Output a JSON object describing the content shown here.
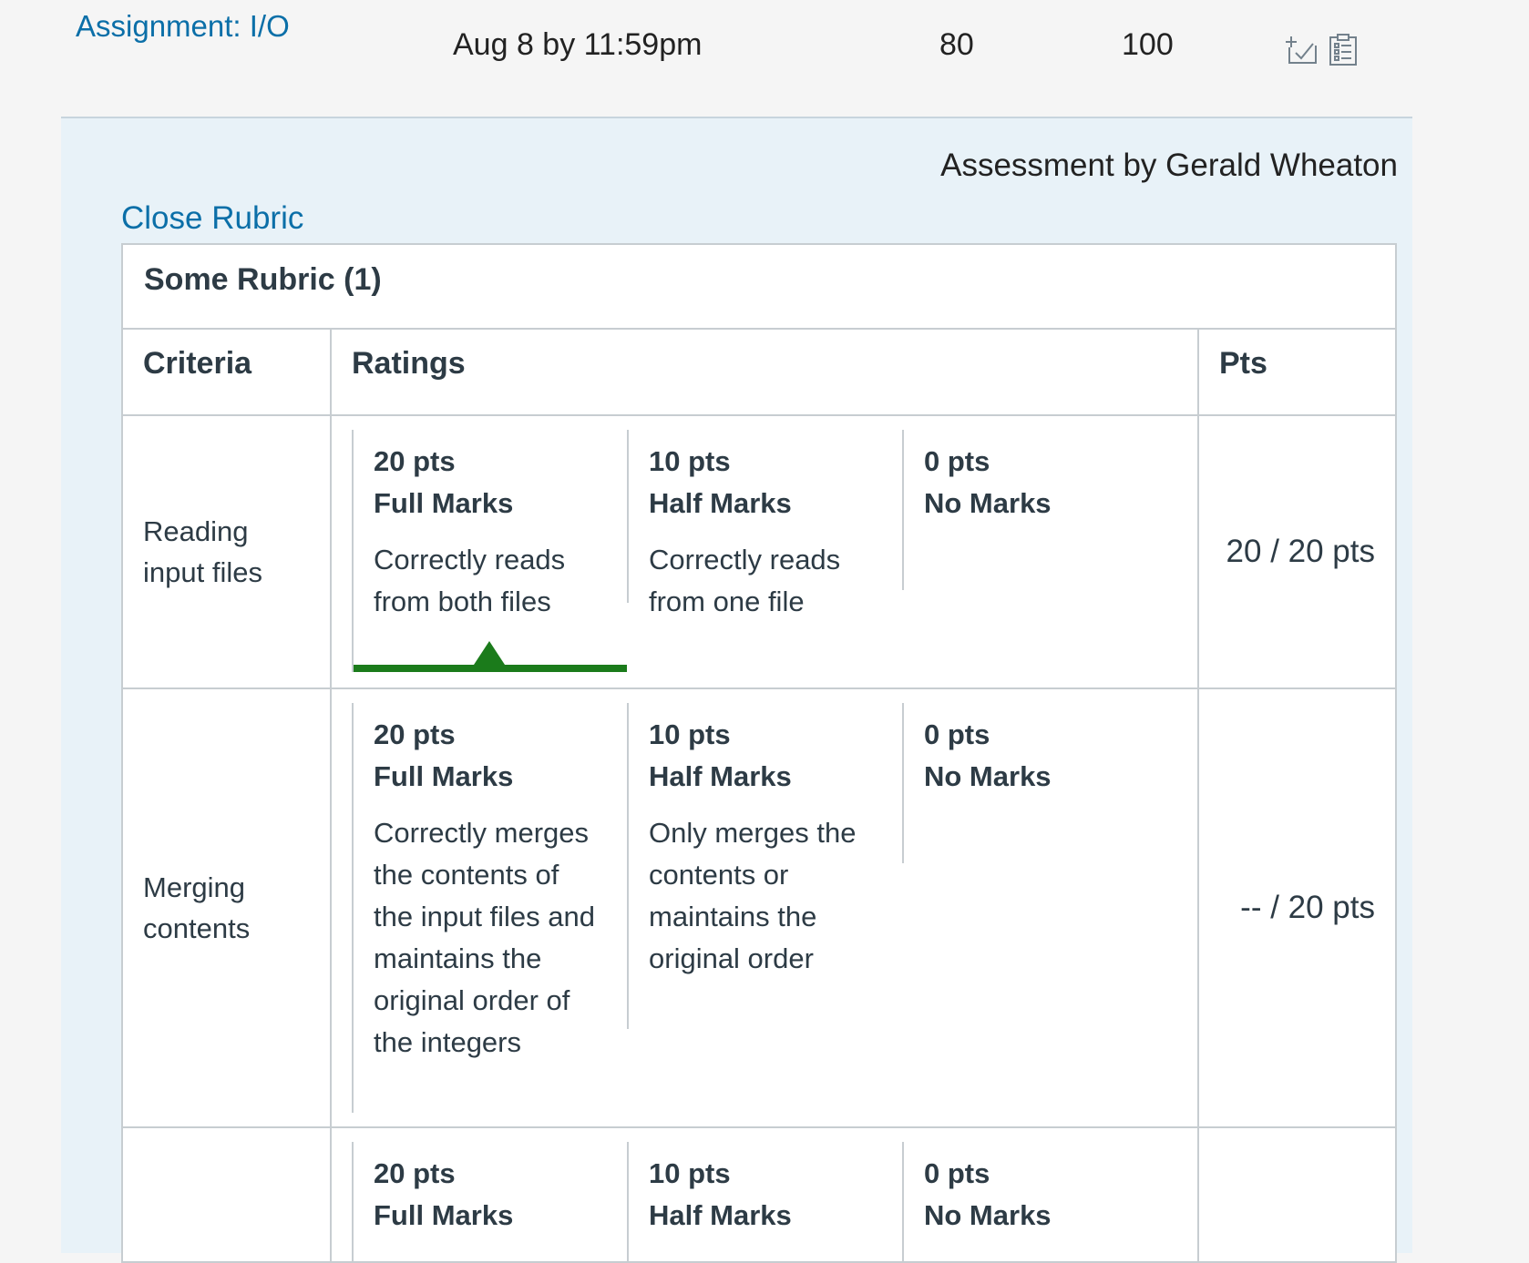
{
  "assignment": {
    "title": "Assignment: I/O",
    "due": "Aug 8 by 11:59pm",
    "score": "80",
    "out_of": "100",
    "icons": [
      "muted-checklist-icon",
      "rubric-clipboard-icon"
    ]
  },
  "rubric": {
    "assessed_by": "Assessment by Gerald Wheaton",
    "close_label": "Close Rubric",
    "title": "Some Rubric (1)",
    "headers": {
      "criteria": "Criteria",
      "ratings": "Ratings",
      "pts": "Pts"
    },
    "criteria": [
      {
        "name": "Reading input files",
        "score": "20 / 20 pts",
        "ratings": [
          {
            "pts": "20 pts",
            "name": "Full Marks",
            "desc": "Correctly reads from both files",
            "selected": true
          },
          {
            "pts": "10 pts",
            "name": "Half Marks",
            "desc": "Correctly reads from one file",
            "selected": false
          },
          {
            "pts": "0 pts",
            "name": "No Marks",
            "desc": "",
            "selected": false
          }
        ]
      },
      {
        "name": "Merging contents",
        "score": "-- / 20 pts",
        "ratings": [
          {
            "pts": "20 pts",
            "name": "Full Marks",
            "desc": "Correctly merges the contents of the input files and maintains the original order of the integers",
            "selected": false
          },
          {
            "pts": "10 pts",
            "name": "Half Marks",
            "desc": "Only merges the contents or maintains the original order",
            "selected": false
          },
          {
            "pts": "0 pts",
            "name": "No Marks",
            "desc": "",
            "selected": false
          }
        ]
      },
      {
        "name": "",
        "score": "",
        "ratings": [
          {
            "pts": "20 pts",
            "name": "Full Marks",
            "desc": "",
            "selected": false
          },
          {
            "pts": "10 pts",
            "name": "Half Marks",
            "desc": "",
            "selected": false
          },
          {
            "pts": "0 pts",
            "name": "No Marks",
            "desc": "",
            "selected": false
          }
        ]
      }
    ]
  }
}
